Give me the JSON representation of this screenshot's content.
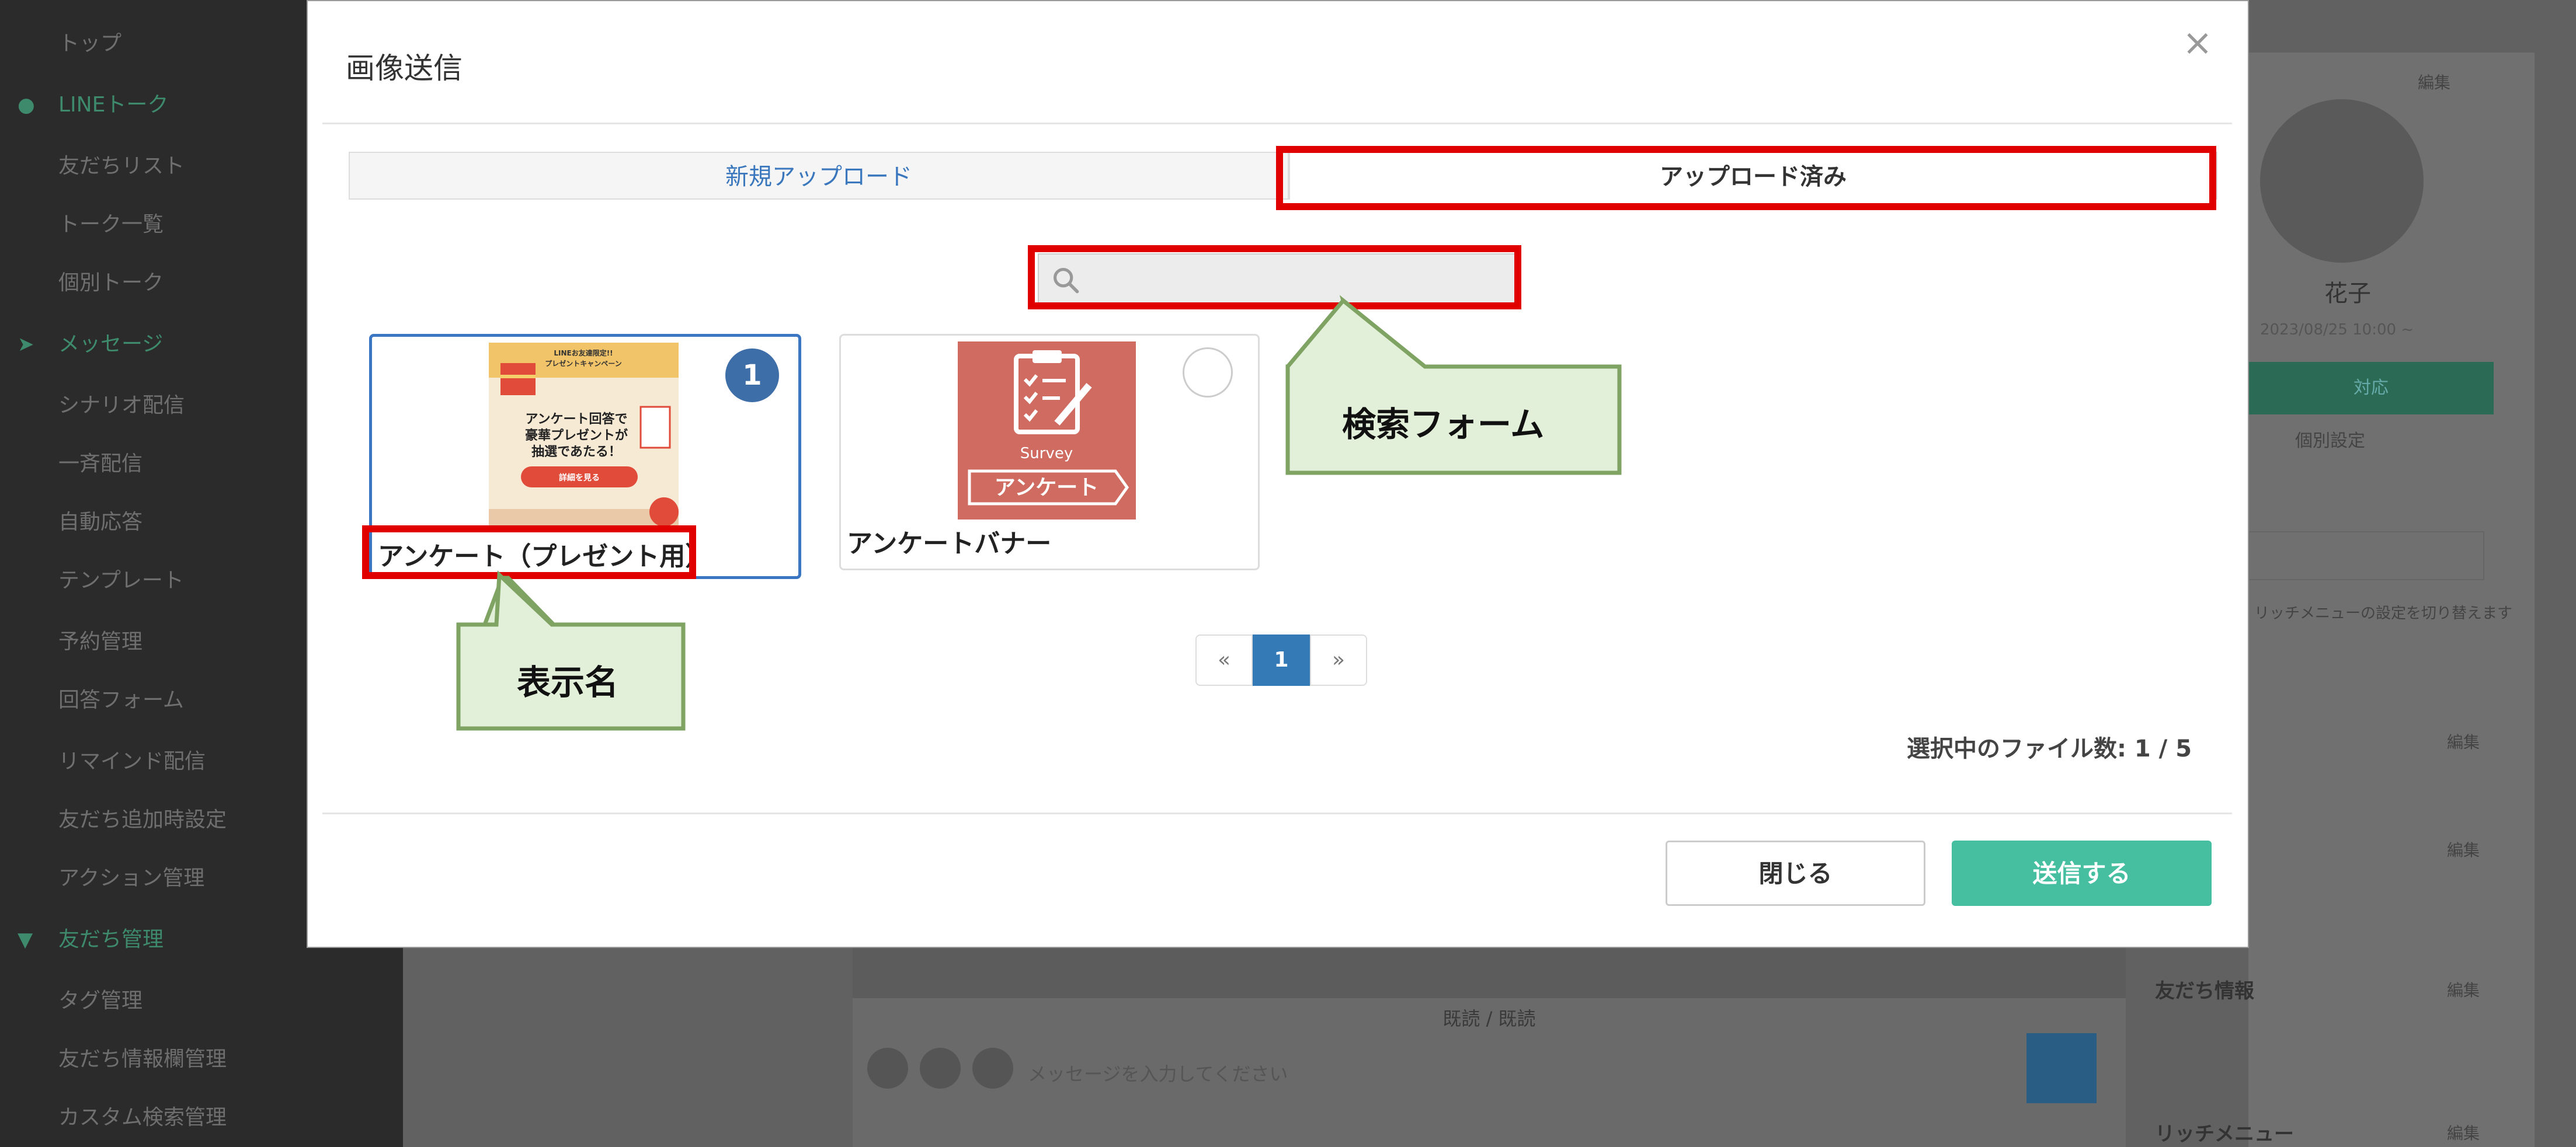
{
  "sidebar": {
    "items": [
      {
        "label": "トップ",
        "section": false
      },
      {
        "label": "LINEトーク",
        "section": true
      },
      {
        "label": "友だちリスト",
        "section": false
      },
      {
        "label": "トーク一覧",
        "section": false
      },
      {
        "label": "個別トーク",
        "section": false
      },
      {
        "label": "メッセージ",
        "section": true
      },
      {
        "label": "シナリオ配信",
        "section": false
      },
      {
        "label": "一斉配信",
        "section": false
      },
      {
        "label": "自動応答",
        "section": false
      },
      {
        "label": "テンプレート",
        "section": false
      },
      {
        "label": "予約管理",
        "section": false
      },
      {
        "label": "回答フォーム",
        "section": false
      },
      {
        "label": "リマインド配信",
        "section": false
      },
      {
        "label": "友だち追加時設定",
        "section": false
      },
      {
        "label": "アクション管理",
        "section": false
      },
      {
        "label": "友だち管理",
        "section": true
      },
      {
        "label": "タグ管理",
        "section": false
      },
      {
        "label": "友だち情報欄管理",
        "section": false
      },
      {
        "label": "カスタム検索管理",
        "section": false
      }
    ]
  },
  "background": {
    "read_label": "既読 / 既読",
    "message_placeholder": "メッセージを入力してください",
    "user_name": "花子",
    "date": "2023/08/25 10:00 ~",
    "block_button": "対応",
    "details_link": "個別設定",
    "select_note": "リッチメニューの設定を切り替えます",
    "edit_label": "編集",
    "info_label": "友だち情報",
    "richmenu_label": "リッチメニュー"
  },
  "modal": {
    "title": "画像送信",
    "close_symbol": "×",
    "tabs": [
      {
        "label": "新規アップロード",
        "active": false
      },
      {
        "label": "アップロード済み",
        "active": true
      }
    ],
    "search": {
      "value": "",
      "placeholder": ""
    },
    "images": [
      {
        "name": "アンケート（プレゼント用）",
        "selected_order": "1",
        "selected": true,
        "thumbnail_text": {
          "header": "LINEお友達限定!!",
          "campaign": "プレゼントキャンペーン",
          "line1": "アンケート回答で",
          "line2": "豪華プレゼントが",
          "line3": "抽選であたる！",
          "button": "詳細を見る"
        }
      },
      {
        "name": "アンケートバナー",
        "selected": false,
        "thumbnail_text": {
          "caption": "Survey",
          "label": "アンケート"
        }
      }
    ],
    "pagination": {
      "prev": "«",
      "current": "1",
      "next": "»"
    },
    "file_count": "選択中のファイル数: 1 / 5",
    "buttons": {
      "close": "閉じる",
      "send": "送信する"
    }
  },
  "callouts": {
    "search_form": "検索フォーム",
    "display_name": "表示名"
  },
  "colors": {
    "highlight_red": "#e00000",
    "callout_fill": "#e2efd9",
    "callout_border": "#7fa363",
    "send_button": "#45bf9f",
    "active_page": "#337ab7",
    "selected_border": "#3b76c3"
  }
}
